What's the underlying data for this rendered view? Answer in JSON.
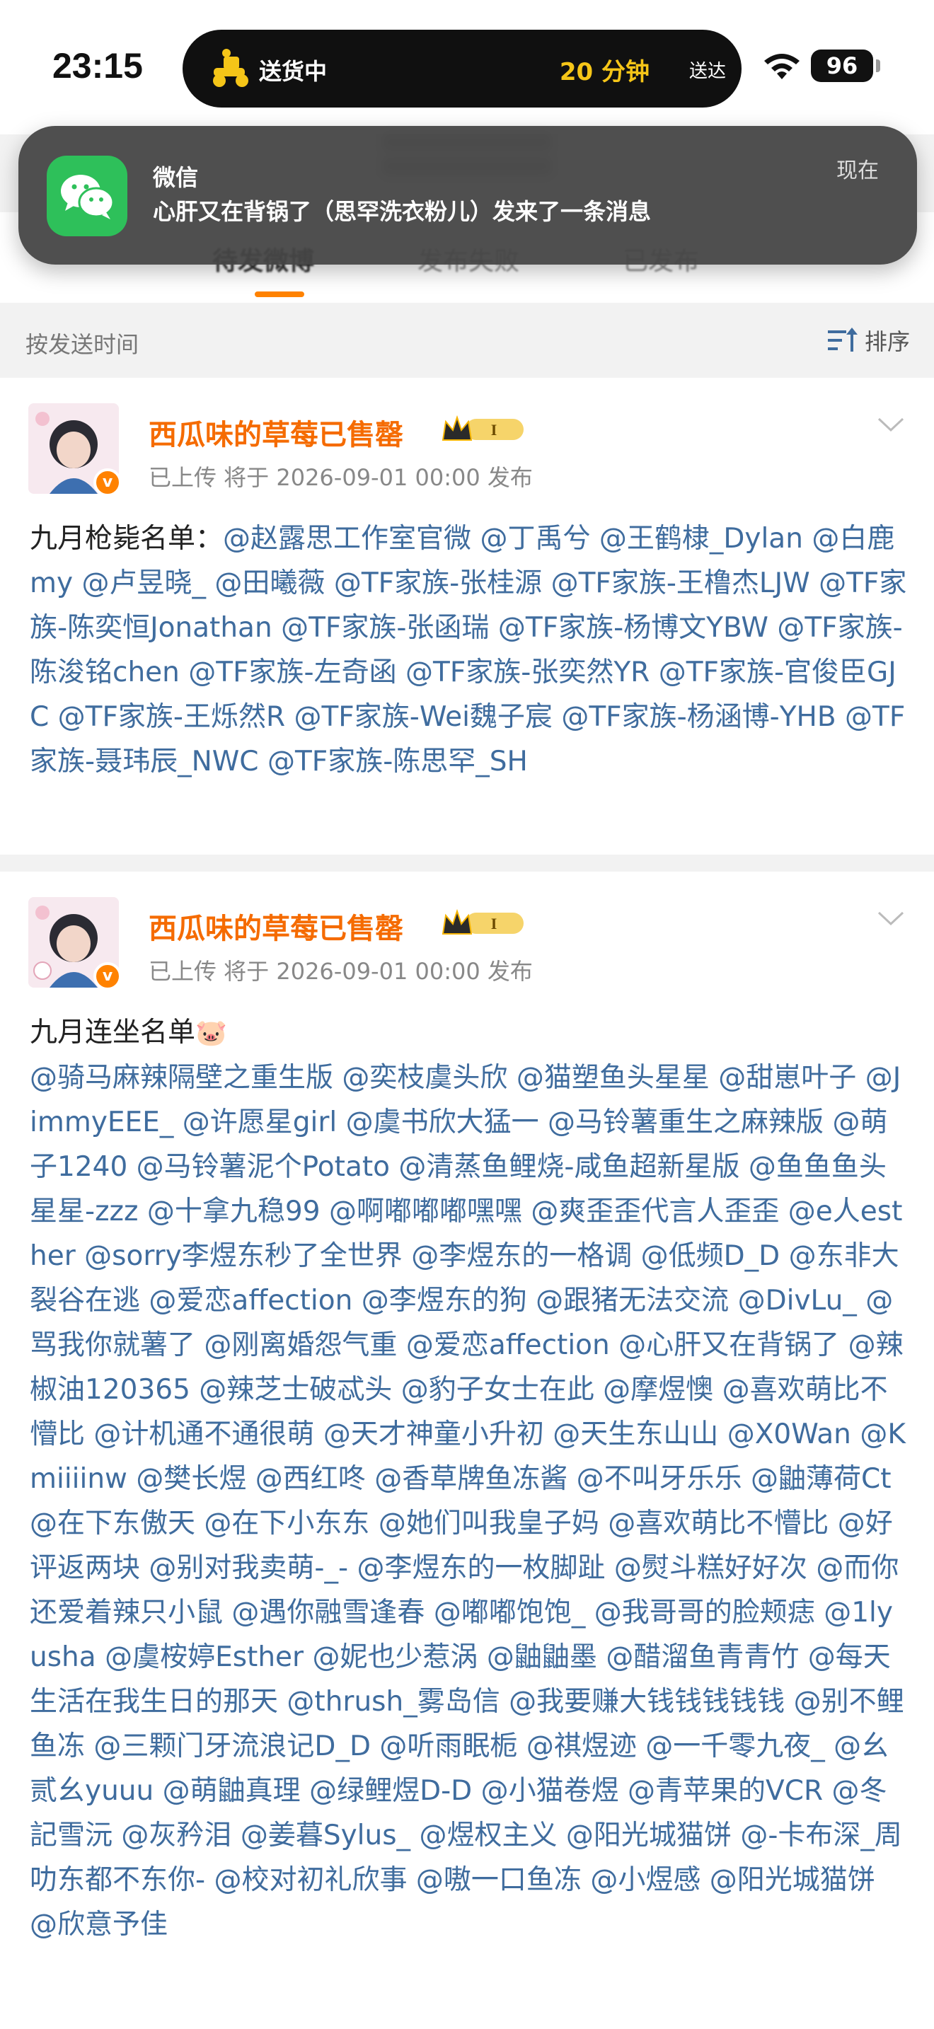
{
  "status_bar": {
    "time": "23:15",
    "island_label": "送货中",
    "island_time": "20 分钟",
    "island_suffix": "送达",
    "battery": "96"
  },
  "notification": {
    "app": "微信",
    "message": "心肝又在背锅了（思罕洗衣粉儿）发来了一条消息",
    "time": "现在"
  },
  "tabs": [
    {
      "label": "待发微博",
      "active": true
    },
    {
      "label": "发布失败",
      "active": false
    },
    {
      "label": "已发布",
      "active": false
    }
  ],
  "sort_bar": {
    "label": "按发送时间",
    "button": "排序"
  },
  "posts": [
    {
      "username": "西瓜味的草莓已售罄",
      "meta": "已上传  将于 2026-09-01 00:00 发布",
      "intro": "九月枪毙名单：",
      "mentions": [
        "@赵露思工作室官微",
        "@丁禹兮",
        "@王鹤棣_Dylan",
        "@白鹿my",
        "@卢昱晓_",
        "@田曦薇",
        "@TF家族-张桂源",
        "@TF家族-王橹杰LJW",
        "@TF家族-陈奕恒Jonathan",
        "@TF家族-张函瑞",
        "@TF家族-杨博文YBW",
        "@TF家族-陈浚铭chen",
        "@TF家族-左奇函",
        "@TF家族-张奕然YR",
        "@TF家族-官俊臣GJC",
        "@TF家族-王烁然R",
        "@TF家族-Wei魏子宸",
        "@TF家族-杨涵博-YHB",
        "@TF家族-聂玮辰_NWC",
        "@TF家族-陈思罕_SH"
      ]
    },
    {
      "username": "西瓜味的草莓已售罄",
      "meta": "已上传  将于 2026-09-01 00:00 发布",
      "intro": "九月连坐名单",
      "intro_emoji": "🐷",
      "mentions": [
        "@骑马麻辣隔壁之重生版",
        "@奕枝虞头欣",
        "@猫塑鱼头星星",
        "@甜崽叶子",
        "@JimmyEEE_",
        "@许愿星girl",
        "@虞书欣大猛一",
        "@马铃薯重生之麻辣版",
        "@萌子1240",
        "@马铃薯泥个Potato",
        "@清蒸鱼鲤烧-咸鱼超新星版",
        "@鱼鱼鱼头星星-zzz",
        "@十拿九稳99",
        "@啊嘟嘟嘟嘿嘿",
        "@爽歪歪代言人歪歪",
        "@e人esther",
        "@sorry李煜东秒了全世界",
        "@李煜东的一格调",
        "@低频D_D",
        "@东非大裂谷在逃",
        "@爱恋affection",
        "@李煜东的狗",
        "@跟猪无法交流",
        "@DivLu_",
        "@骂我你就薯了",
        "@刚离婚怨气重",
        "@爱恋affection",
        "@心肝又在背锅了",
        "@辣椒油120365",
        "@辣芝士破忒头",
        "@豹子女士在此",
        "@摩煜懊",
        "@喜欢萌比不懵比",
        "@计机通不通很萌",
        "@天才神童小升初",
        "@天生东山山",
        "@X0Wan",
        "@Kmiiiinw",
        "@樊长煜",
        "@西红咚",
        "@香草牌鱼冻酱",
        "@不叫牙乐乐",
        "@鼬薄荷Ct",
        "@在下东傲天",
        "@在下小东东",
        "@她们叫我皇子妈",
        "@喜欢萌比不懵比",
        "@好评返两块",
        "@别对我卖萌-_-",
        "@李煜东的一枚脚趾",
        "@熨斗糕好好次",
        "@而你还爱着辣只小鼠",
        "@遇你融雪逢春",
        "@嘟嘟饱饱_",
        "@我哥哥的脸颊痣",
        "@1lyusha",
        "@虞桉婷Esther",
        "@妮也少惹涡",
        "@鼬鼬墨",
        "@醋溜鱼青青竹",
        "@每天生活在我生日的那天",
        "@thrush_雾岛信",
        "@我要赚大钱钱钱钱钱",
        "@别不鲤鱼冻",
        "@三颗门牙流浪记D_D",
        "@听雨眠栀",
        "@祺煜迹",
        "@一千零九夜_",
        "@幺贰幺yuuu",
        "@萌鼬真理",
        "@绿鲤煜D-D",
        "@小猫卷煜",
        "@青苹果的VCR",
        "@冬記雪沅",
        "@灰矜泪",
        "@姜暮Sylus_",
        "@煜权主义",
        "@阳光城猫饼",
        "@-卡布深_周叻东都不东你-",
        "@校对初礼欣事",
        "@嗷一口鱼冻",
        "@小煜感",
        "@阳光城猫饼",
        "@欣意予佳"
      ]
    }
  ],
  "colors": {
    "accent": "#ff8200",
    "username": "#f56b00",
    "mention": "#3f6c9e",
    "wechat_green": "#2ec05a"
  }
}
